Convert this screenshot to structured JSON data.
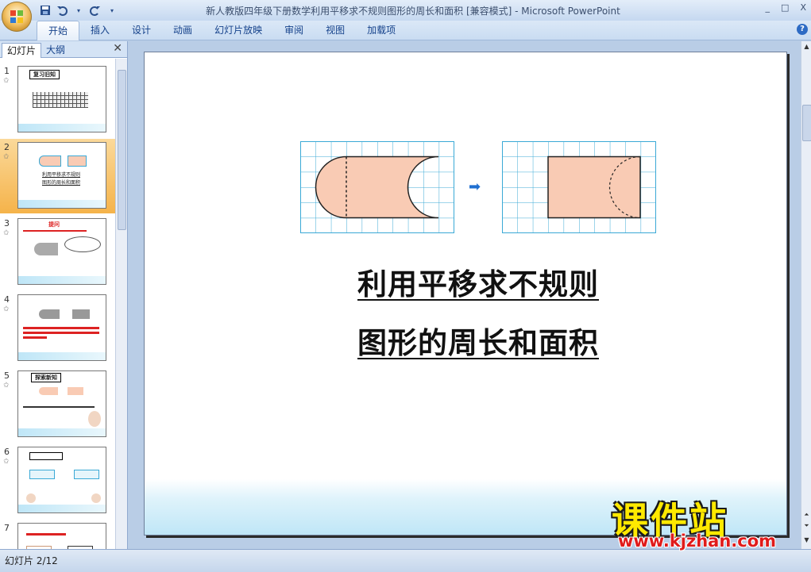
{
  "app": {
    "title": "新人教版四年级下册数学利用平移求不规则图形的周长和面积 [兼容模式] - Microsoft PowerPoint",
    "window_controls": {
      "minimize": "_",
      "maximize": "□",
      "close": "X"
    }
  },
  "ribbon": {
    "tabs": [
      {
        "label": "开始",
        "active": true
      },
      {
        "label": "插入"
      },
      {
        "label": "设计"
      },
      {
        "label": "动画"
      },
      {
        "label": "幻灯片放映"
      },
      {
        "label": "审阅"
      },
      {
        "label": "视图"
      },
      {
        "label": "加载项"
      }
    ],
    "help_icon": "?"
  },
  "panel": {
    "tab_slides": "幻灯片",
    "tab_outline": "大纲",
    "close_icon": "✕",
    "thumbnails": [
      {
        "num": "1",
        "label": "复习旧知"
      },
      {
        "num": "2",
        "label": "利用平移求不规则图形的周长和面积",
        "selected": true
      },
      {
        "num": "3",
        "label": "提问"
      },
      {
        "num": "4",
        "label": ""
      },
      {
        "num": "5",
        "label": "探索新知"
      },
      {
        "num": "6",
        "label": ""
      },
      {
        "num": "7",
        "label": ""
      }
    ],
    "star": "✩"
  },
  "slide": {
    "title_line1": "利用平移求不规则",
    "title_line2": "图形的周长和面积",
    "arrow": "➡"
  },
  "status": {
    "slide_indicator": "幻灯片 2/12"
  },
  "watermark": {
    "brand": "课件站",
    "url": "www.kjzhan.com"
  },
  "colors": {
    "shape_fill": "#f9cbb4",
    "grid_line": "#3aa9d6",
    "selected_thumb": "#f5b34a",
    "arrow": "#1f6fd1"
  }
}
